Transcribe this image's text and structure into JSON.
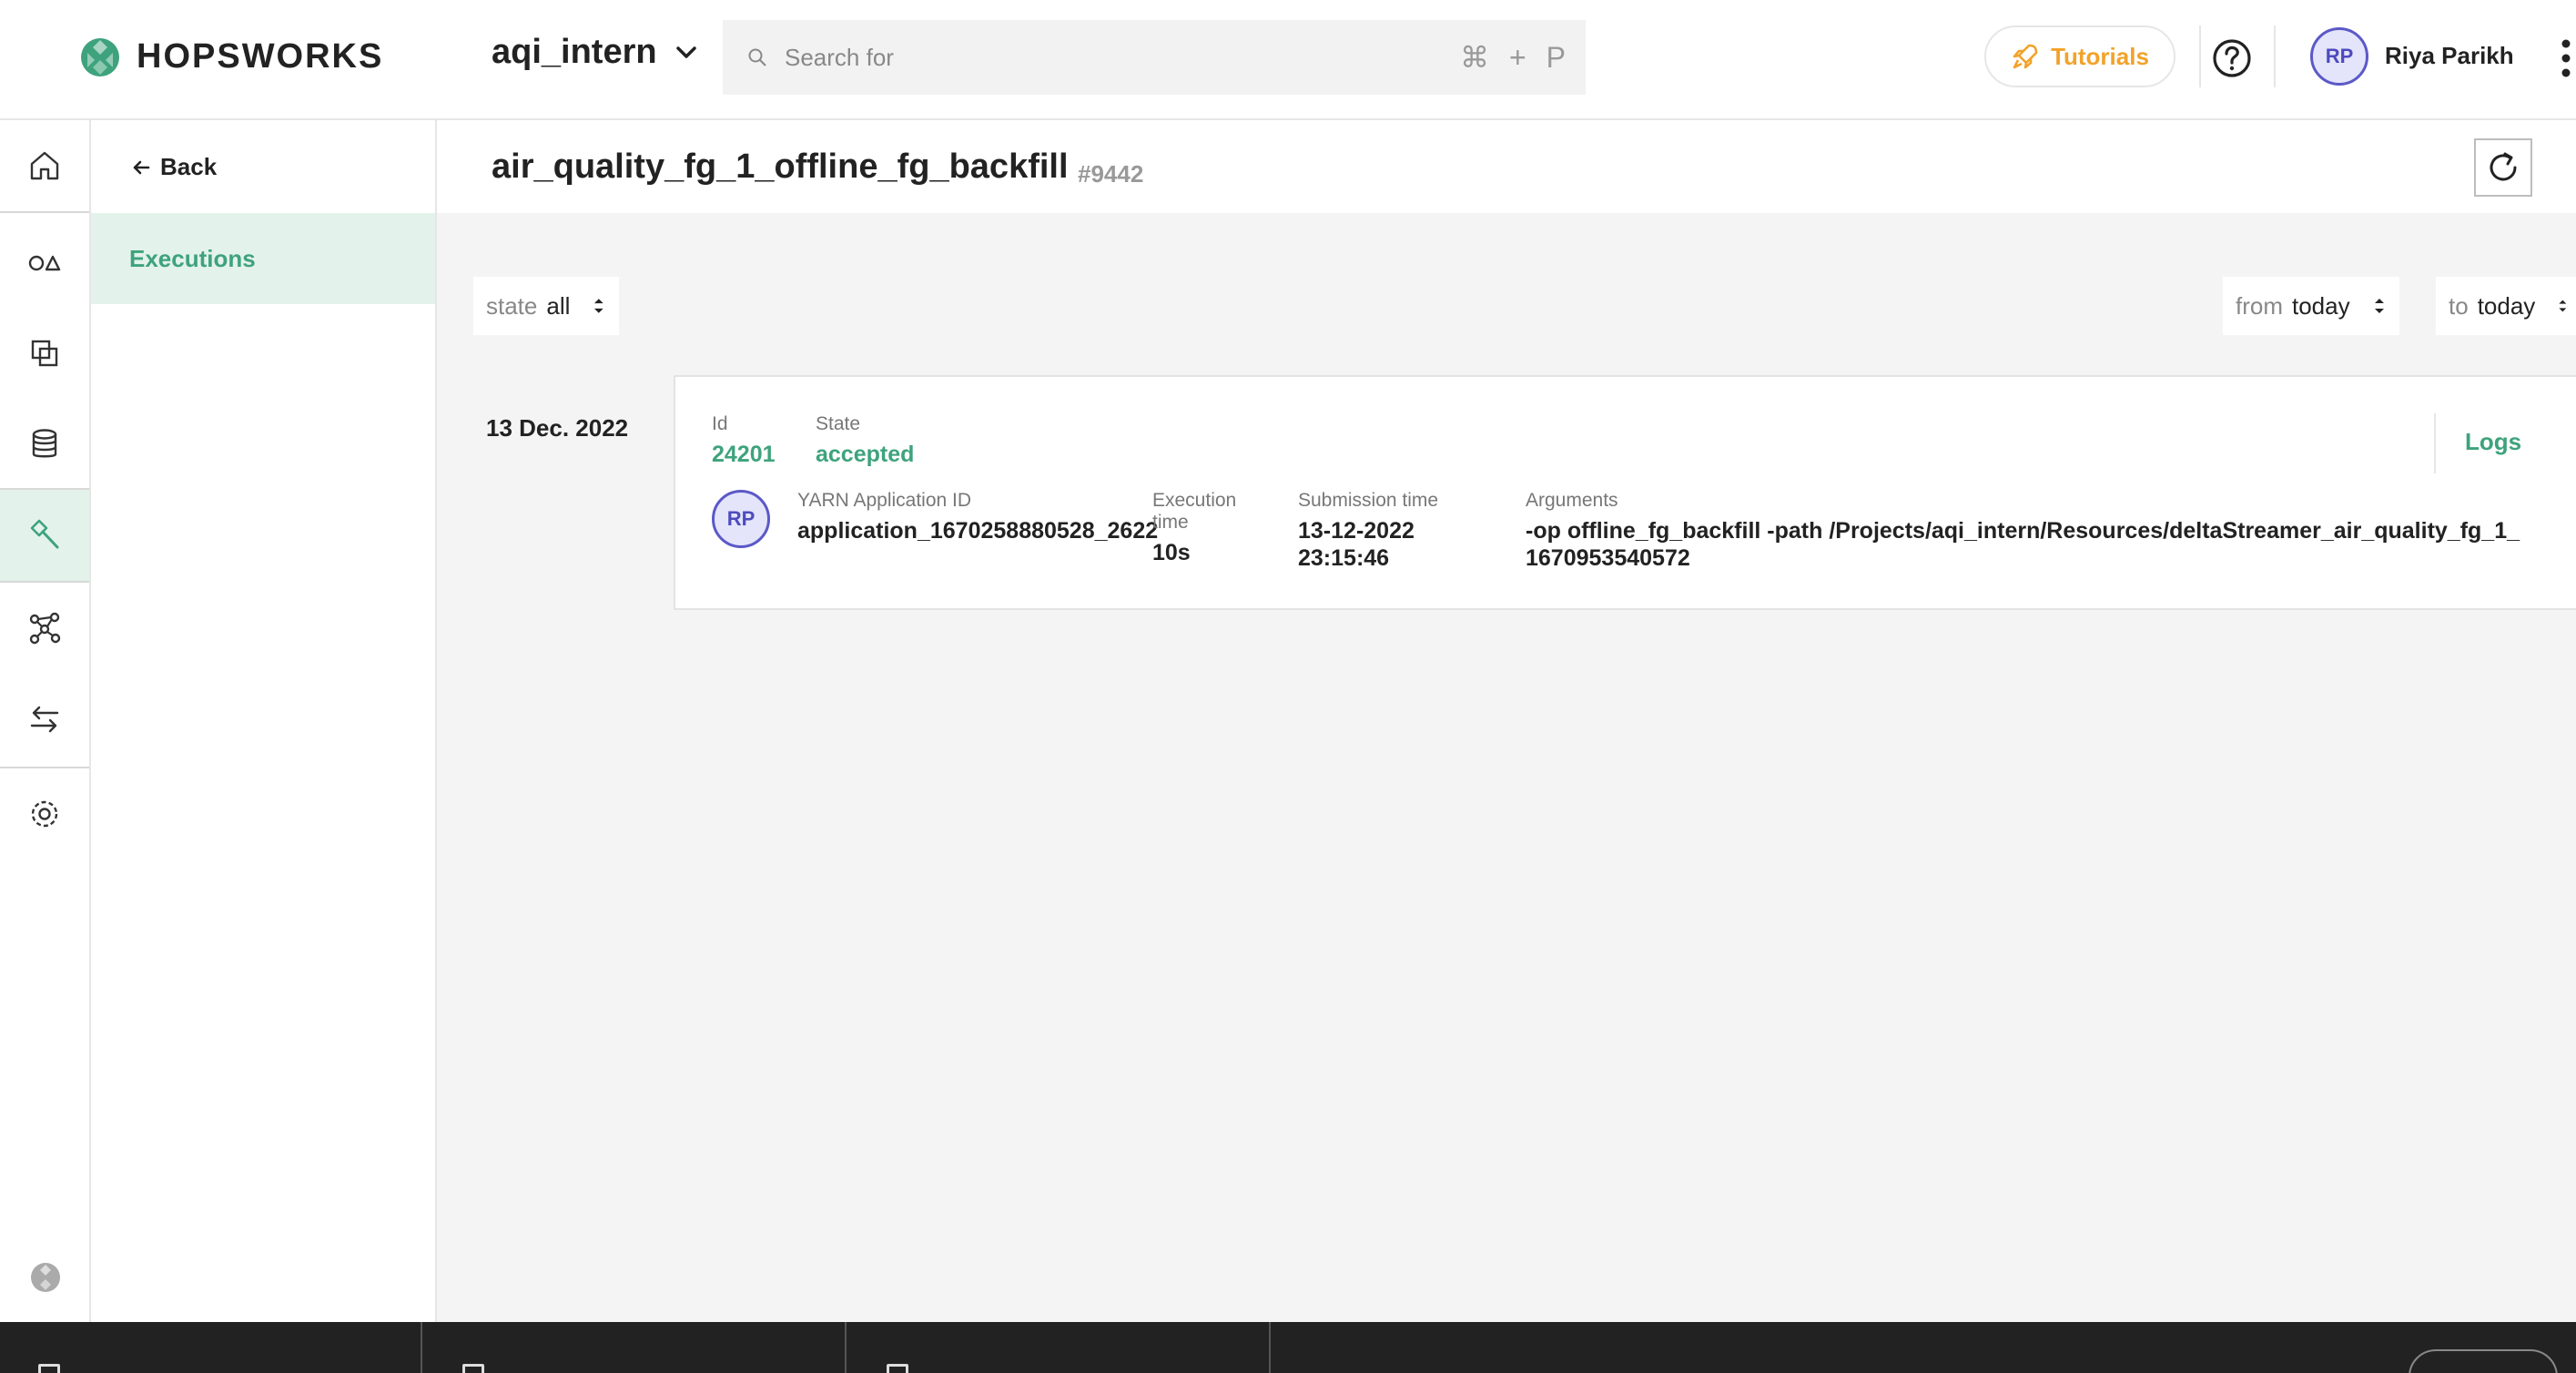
{
  "app": {
    "logo_text": "HOPSWORKS",
    "project_name": "aqi_intern",
    "search": {
      "placeholder": "Search for",
      "shortcut": [
        "⌘",
        "+",
        "P"
      ]
    },
    "tutorials_label": "Tutorials",
    "user": {
      "initials": "RP",
      "name": "Riya Parikh"
    }
  },
  "colors": {
    "accent": "#3ea37c",
    "tutorials": "#f2a22a",
    "avatar": "#5b59c7"
  },
  "rail": {
    "items": [
      {
        "name": "home-icon",
        "active": false
      },
      {
        "name": "feature-store-icon",
        "active": false
      },
      {
        "name": "feature-views-icon",
        "active": false
      },
      {
        "name": "database-icon",
        "active": false
      },
      {
        "name": "jobs-icon",
        "active": true
      },
      {
        "name": "graph-icon",
        "active": false
      },
      {
        "name": "transfer-icon",
        "active": false
      },
      {
        "name": "settings-icon",
        "active": false
      }
    ]
  },
  "subnav": {
    "back_label": "Back",
    "active_item": "Executions"
  },
  "page": {
    "title": "air_quality_fg_1_offline_fg_backfill",
    "id": "#9442",
    "filters": {
      "state": {
        "label": "state",
        "value": "all"
      },
      "from": {
        "label": "from",
        "value": "today"
      },
      "to": {
        "label": "to",
        "value": "today"
      }
    }
  },
  "executions": [
    {
      "date": "13 Dec. 2022",
      "id_label": "Id",
      "id": "24201",
      "state_label": "State",
      "state": "accepted",
      "avatar": "RP",
      "yarn_label": "YARN Application ID",
      "yarn_id": "application_1670258880528_2622",
      "exec_time_label": "Execution time",
      "exec_time": "10s",
      "submission_label": "Submission time",
      "submission_date": "13-12-2022",
      "submission_time": "23:15:46",
      "arguments_label": "Arguments",
      "arguments_line1": "-op offline_fg_backfill -path /Projects/aqi_intern/Resources/deltaStreamer_air_quality_fg_1_",
      "arguments_line2": "1670953540572",
      "logs_label": "Logs"
    }
  ],
  "bottom_bar": {
    "tabs": [
      "",
      "",
      ""
    ],
    "button": ""
  }
}
